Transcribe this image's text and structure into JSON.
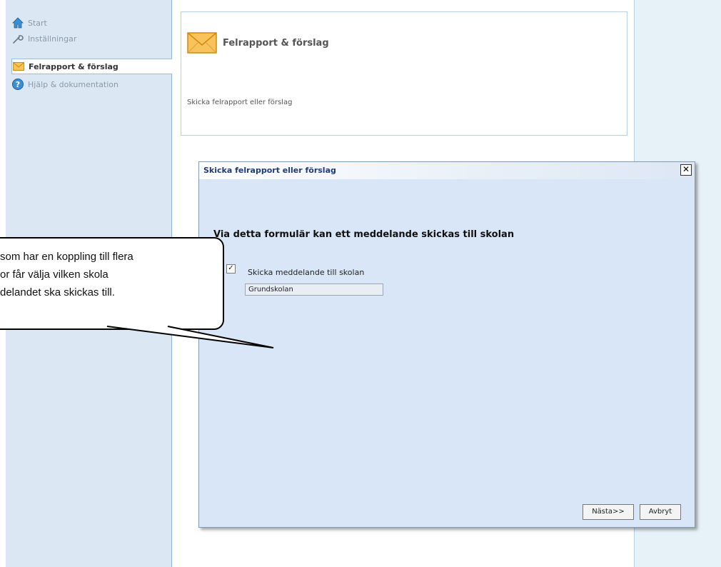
{
  "sidebar": {
    "items": [
      {
        "label": "Start",
        "icon": "home-icon"
      },
      {
        "label": "Inställningar",
        "icon": "wrench-icon"
      },
      {
        "label": "Felrapport & förslag",
        "icon": "envelope-icon"
      },
      {
        "label": "Hjälp & dokumentation",
        "icon": "help-icon"
      }
    ],
    "active_index": 2
  },
  "header": {
    "title": "Felrapport & förslag",
    "subtitle": "Skicka felrapport eller förslag"
  },
  "dialog": {
    "title": "Skicka felrapport eller förslag",
    "heading": "Via detta formulär kan ett meddelande skickas till skolan",
    "checkbox_label": "Skicka meddelande till skolan",
    "checkbox_checked": true,
    "school_value": "Grundskolan",
    "next_label": "Nästa>>",
    "cancel_label": "Avbryt"
  },
  "callout": {
    "lines": [
      "som har en koppling till flera",
      "or får välja vilken skola",
      "delandet ska skickas till."
    ]
  },
  "colors": {
    "sidebar_bg": "#dbe8f3",
    "dialog_bg": "#d9e6f7",
    "dialog_title": "#203a74",
    "envelope": "#f2a623"
  }
}
